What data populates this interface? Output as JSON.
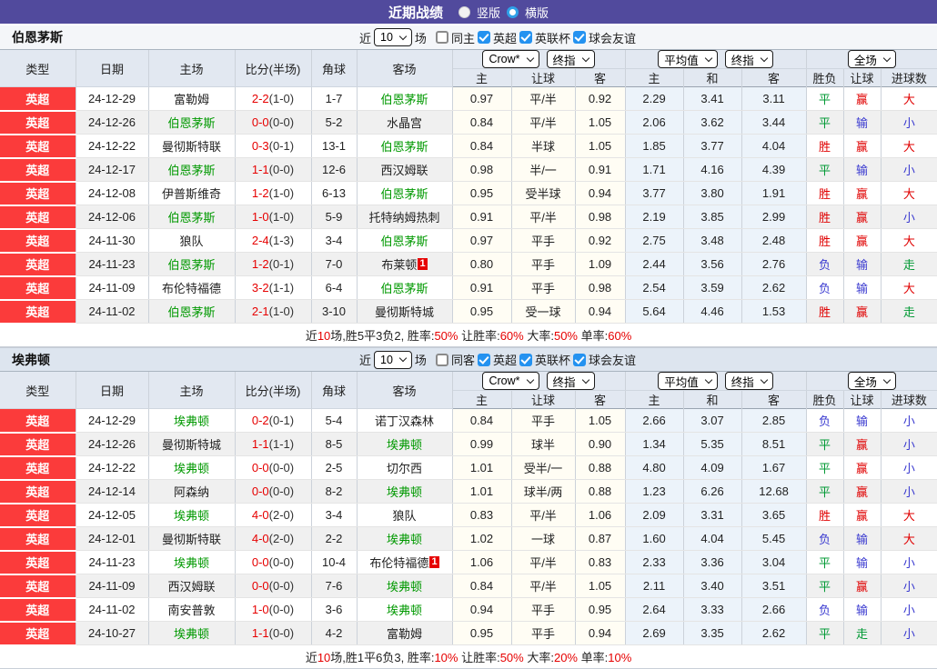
{
  "titlebar": {
    "title": "近期战绩",
    "radios": [
      {
        "label": "竖版",
        "checked": false
      },
      {
        "label": "横版",
        "checked": true
      }
    ]
  },
  "columns": {
    "type": "类型",
    "date": "日期",
    "home": "主场",
    "score": "比分(半场)",
    "corner": "角球",
    "away": "客场",
    "odds_group": {
      "select1": "Crow*",
      "select2": "终指",
      "cols": [
        "主",
        "让球",
        "客"
      ]
    },
    "avg_group": {
      "select1": "平均值",
      "select2": "终指",
      "cols": [
        "主",
        "和",
        "客"
      ]
    },
    "result_group": {
      "select": "全场",
      "cols": [
        "胜负",
        "让球",
        "进球数"
      ]
    }
  },
  "result_colors": {
    "胜": "#e00000",
    "赢": "#e00000",
    "大": "#e00000",
    "平": "#009933",
    "走": "#009933",
    "负": "#3a3ad0",
    "输": "#3a3ad0",
    "小": "#3a3ad0"
  },
  "sections": [
    {
      "team": "伯恩茅斯",
      "filter": {
        "near": "近",
        "count": "10",
        "games": "场",
        "same_label": "同主",
        "same_checked": false,
        "leagues": [
          {
            "label": "英超",
            "checked": true
          },
          {
            "label": "英联杯",
            "checked": true
          },
          {
            "label": "球会友谊",
            "checked": true
          }
        ]
      },
      "rows": [
        {
          "type": "英超",
          "date": "24-12-29",
          "home": {
            "name": "富勒姆"
          },
          "score": "2-2",
          "half": "(1-0)",
          "corner": "1-7",
          "away": {
            "name": "伯恩茅斯",
            "focus": true
          },
          "odds": [
            "0.97",
            "平/半",
            "0.92"
          ],
          "avg": [
            "2.29",
            "3.41",
            "3.11"
          ],
          "result": [
            "平",
            "赢",
            "大"
          ]
        },
        {
          "type": "英超",
          "date": "24-12-26",
          "home": {
            "name": "伯恩茅斯",
            "focus": true
          },
          "score": "0-0",
          "half": "(0-0)",
          "corner": "5-2",
          "away": {
            "name": "水晶宫"
          },
          "odds": [
            "0.84",
            "平/半",
            "1.05"
          ],
          "avg": [
            "2.06",
            "3.62",
            "3.44"
          ],
          "result": [
            "平",
            "输",
            "小"
          ]
        },
        {
          "type": "英超",
          "date": "24-12-22",
          "home": {
            "name": "曼彻斯特联"
          },
          "score": "0-3",
          "half": "(0-1)",
          "corner": "13-1",
          "away": {
            "name": "伯恩茅斯",
            "focus": true
          },
          "odds": [
            "0.84",
            "半球",
            "1.05"
          ],
          "avg": [
            "1.85",
            "3.77",
            "4.04"
          ],
          "result": [
            "胜",
            "赢",
            "大"
          ]
        },
        {
          "type": "英超",
          "date": "24-12-17",
          "home": {
            "name": "伯恩茅斯",
            "focus": true
          },
          "score": "1-1",
          "half": "(0-0)",
          "corner": "12-6",
          "away": {
            "name": "西汉姆联"
          },
          "odds": [
            "0.98",
            "半/一",
            "0.91"
          ],
          "avg": [
            "1.71",
            "4.16",
            "4.39"
          ],
          "result": [
            "平",
            "输",
            "小"
          ]
        },
        {
          "type": "英超",
          "date": "24-12-08",
          "home": {
            "name": "伊普斯维奇"
          },
          "score": "1-2",
          "half": "(1-0)",
          "corner": "6-13",
          "away": {
            "name": "伯恩茅斯",
            "focus": true
          },
          "odds": [
            "0.95",
            "受半球",
            "0.94"
          ],
          "avg": [
            "3.77",
            "3.80",
            "1.91"
          ],
          "result": [
            "胜",
            "赢",
            "大"
          ]
        },
        {
          "type": "英超",
          "date": "24-12-06",
          "home": {
            "name": "伯恩茅斯",
            "focus": true
          },
          "score": "1-0",
          "half": "(1-0)",
          "corner": "5-9",
          "away": {
            "name": "托特纳姆热刺"
          },
          "odds": [
            "0.91",
            "平/半",
            "0.98"
          ],
          "avg": [
            "2.19",
            "3.85",
            "2.99"
          ],
          "result": [
            "胜",
            "赢",
            "小"
          ]
        },
        {
          "type": "英超",
          "date": "24-11-30",
          "home": {
            "name": "狼队"
          },
          "score": "2-4",
          "half": "(1-3)",
          "corner": "3-4",
          "away": {
            "name": "伯恩茅斯",
            "focus": true
          },
          "odds": [
            "0.97",
            "平手",
            "0.92"
          ],
          "avg": [
            "2.75",
            "3.48",
            "2.48"
          ],
          "result": [
            "胜",
            "赢",
            "大"
          ]
        },
        {
          "type": "英超",
          "date": "24-11-23",
          "home": {
            "name": "伯恩茅斯",
            "focus": true
          },
          "score": "1-2",
          "half": "(0-1)",
          "corner": "7-0",
          "away": {
            "name": "布莱顿",
            "badge": "1"
          },
          "odds": [
            "0.80",
            "平手",
            "1.09"
          ],
          "avg": [
            "2.44",
            "3.56",
            "2.76"
          ],
          "result": [
            "负",
            "输",
            "走"
          ]
        },
        {
          "type": "英超",
          "date": "24-11-09",
          "home": {
            "name": "布伦特福德"
          },
          "score": "3-2",
          "half": "(1-1)",
          "corner": "6-4",
          "away": {
            "name": "伯恩茅斯",
            "focus": true
          },
          "odds": [
            "0.91",
            "平手",
            "0.98"
          ],
          "avg": [
            "2.54",
            "3.59",
            "2.62"
          ],
          "result": [
            "负",
            "输",
            "大"
          ]
        },
        {
          "type": "英超",
          "date": "24-11-02",
          "home": {
            "name": "伯恩茅斯",
            "focus": true
          },
          "score": "2-1",
          "half": "(1-0)",
          "corner": "3-10",
          "away": {
            "name": "曼彻斯特城"
          },
          "odds": [
            "0.95",
            "受一球",
            "0.94"
          ],
          "avg": [
            "5.64",
            "4.46",
            "1.53"
          ],
          "result": [
            "胜",
            "赢",
            "走"
          ]
        }
      ],
      "summary": [
        {
          "text": "近"
        },
        {
          "text": "10",
          "red": true
        },
        {
          "text": "场,胜5平3负2, 胜率:"
        },
        {
          "text": "50%",
          "red": true
        },
        {
          "text": " 让胜率:"
        },
        {
          "text": "60%",
          "red": true
        },
        {
          "text": " 大率:"
        },
        {
          "text": "50%",
          "red": true
        },
        {
          "text": " 单率:"
        },
        {
          "text": "60%",
          "red": true
        }
      ]
    },
    {
      "team": "埃弗顿",
      "filter": {
        "near": "近",
        "count": "10",
        "games": "场",
        "same_label": "同客",
        "same_checked": false,
        "leagues": [
          {
            "label": "英超",
            "checked": true
          },
          {
            "label": "英联杯",
            "checked": true
          },
          {
            "label": "球会友谊",
            "checked": true
          }
        ]
      },
      "rows": [
        {
          "type": "英超",
          "date": "24-12-29",
          "home": {
            "name": "埃弗顿",
            "focus": true
          },
          "score": "0-2",
          "half": "(0-1)",
          "corner": "5-4",
          "away": {
            "name": "诺丁汉森林"
          },
          "odds": [
            "0.84",
            "平手",
            "1.05"
          ],
          "avg": [
            "2.66",
            "3.07",
            "2.85"
          ],
          "result": [
            "负",
            "输",
            "小"
          ]
        },
        {
          "type": "英超",
          "date": "24-12-26",
          "home": {
            "name": "曼彻斯特城"
          },
          "score": "1-1",
          "half": "(1-1)",
          "corner": "8-5",
          "away": {
            "name": "埃弗顿",
            "focus": true
          },
          "odds": [
            "0.99",
            "球半",
            "0.90"
          ],
          "avg": [
            "1.34",
            "5.35",
            "8.51"
          ],
          "result": [
            "平",
            "赢",
            "小"
          ]
        },
        {
          "type": "英超",
          "date": "24-12-22",
          "home": {
            "name": "埃弗顿",
            "focus": true
          },
          "score": "0-0",
          "half": "(0-0)",
          "corner": "2-5",
          "away": {
            "name": "切尔西"
          },
          "odds": [
            "1.01",
            "受半/一",
            "0.88"
          ],
          "avg": [
            "4.80",
            "4.09",
            "1.67"
          ],
          "result": [
            "平",
            "赢",
            "小"
          ]
        },
        {
          "type": "英超",
          "date": "24-12-14",
          "home": {
            "name": "阿森纳"
          },
          "score": "0-0",
          "half": "(0-0)",
          "corner": "8-2",
          "away": {
            "name": "埃弗顿",
            "focus": true
          },
          "odds": [
            "1.01",
            "球半/两",
            "0.88"
          ],
          "avg": [
            "1.23",
            "6.26",
            "12.68"
          ],
          "result": [
            "平",
            "赢",
            "小"
          ]
        },
        {
          "type": "英超",
          "date": "24-12-05",
          "home": {
            "name": "埃弗顿",
            "focus": true
          },
          "score": "4-0",
          "half": "(2-0)",
          "corner": "3-4",
          "away": {
            "name": "狼队"
          },
          "odds": [
            "0.83",
            "平/半",
            "1.06"
          ],
          "avg": [
            "2.09",
            "3.31",
            "3.65"
          ],
          "result": [
            "胜",
            "赢",
            "大"
          ]
        },
        {
          "type": "英超",
          "date": "24-12-01",
          "home": {
            "name": "曼彻斯特联"
          },
          "score": "4-0",
          "half": "(2-0)",
          "corner": "2-2",
          "away": {
            "name": "埃弗顿",
            "focus": true
          },
          "odds": [
            "1.02",
            "一球",
            "0.87"
          ],
          "avg": [
            "1.60",
            "4.04",
            "5.45"
          ],
          "result": [
            "负",
            "输",
            "大"
          ]
        },
        {
          "type": "英超",
          "date": "24-11-23",
          "home": {
            "name": "埃弗顿",
            "focus": true
          },
          "score": "0-0",
          "half": "(0-0)",
          "corner": "10-4",
          "away": {
            "name": "布伦特福德",
            "badge": "1"
          },
          "odds": [
            "1.06",
            "平/半",
            "0.83"
          ],
          "avg": [
            "2.33",
            "3.36",
            "3.04"
          ],
          "result": [
            "平",
            "输",
            "小"
          ]
        },
        {
          "type": "英超",
          "date": "24-11-09",
          "home": {
            "name": "西汉姆联"
          },
          "score": "0-0",
          "half": "(0-0)",
          "corner": "7-6",
          "away": {
            "name": "埃弗顿",
            "focus": true
          },
          "odds": [
            "0.84",
            "平/半",
            "1.05"
          ],
          "avg": [
            "2.11",
            "3.40",
            "3.51"
          ],
          "result": [
            "平",
            "赢",
            "小"
          ]
        },
        {
          "type": "英超",
          "date": "24-11-02",
          "home": {
            "name": "南安普敦"
          },
          "score": "1-0",
          "half": "(0-0)",
          "corner": "3-6",
          "away": {
            "name": "埃弗顿",
            "focus": true
          },
          "odds": [
            "0.94",
            "平手",
            "0.95"
          ],
          "avg": [
            "2.64",
            "3.33",
            "2.66"
          ],
          "result": [
            "负",
            "输",
            "小"
          ]
        },
        {
          "type": "英超",
          "date": "24-10-27",
          "home": {
            "name": "埃弗顿",
            "focus": true
          },
          "score": "1-1",
          "half": "(0-0)",
          "corner": "4-2",
          "away": {
            "name": "富勒姆"
          },
          "odds": [
            "0.95",
            "平手",
            "0.94"
          ],
          "avg": [
            "2.69",
            "3.35",
            "2.62"
          ],
          "result": [
            "平",
            "走",
            "小"
          ]
        }
      ],
      "summary": [
        {
          "text": "近"
        },
        {
          "text": "10",
          "red": true
        },
        {
          "text": "场,胜1平6负3, 胜率:"
        },
        {
          "text": "10%",
          "red": true
        },
        {
          "text": " 让胜率:"
        },
        {
          "text": "50%",
          "red": true
        },
        {
          "text": " 大率:"
        },
        {
          "text": "20%",
          "red": true
        },
        {
          "text": " 单率:"
        },
        {
          "text": "10%",
          "red": true
        }
      ]
    }
  ]
}
